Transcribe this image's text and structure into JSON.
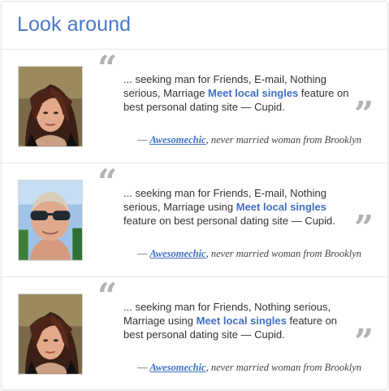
{
  "page": {
    "title": "Look around"
  },
  "testimonials": [
    {
      "avatar": "woman-photo",
      "text_before": "... seeking man for Friends, E-mail, Nothing serious, Marriage ",
      "link": "Meet local singles",
      "text_after": " feature on best personal dating site — Cupid.",
      "dash": "—",
      "username": "Awesomechic",
      "description": ", never married woman from Brooklyn"
    },
    {
      "avatar": "man-photo",
      "text_before": "... seeking man for Friends, E-mail, Nothing serious, Marriage using ",
      "link": "Meet local singles",
      "text_after": " feature on best personal dating site — Cupid.",
      "dash": "—",
      "username": "Awesomechic",
      "description": ", never married woman from Brooklyn"
    },
    {
      "avatar": "woman-photo",
      "text_before": "... seeking man for Friends, Nothing serious, Marriage using ",
      "link": "Meet local singles",
      "text_after": " feature on best personal dating site — Cupid.",
      "dash": "—",
      "username": "Awesomechic",
      "description": ", never married woman from Brooklyn"
    }
  ],
  "quote_marks": {
    "open": "“",
    "close": "”"
  },
  "colors": {
    "accent": "#4a78c8",
    "link": "#3f6fc4",
    "quote": "#b3b3b3",
    "text": "#333333"
  }
}
